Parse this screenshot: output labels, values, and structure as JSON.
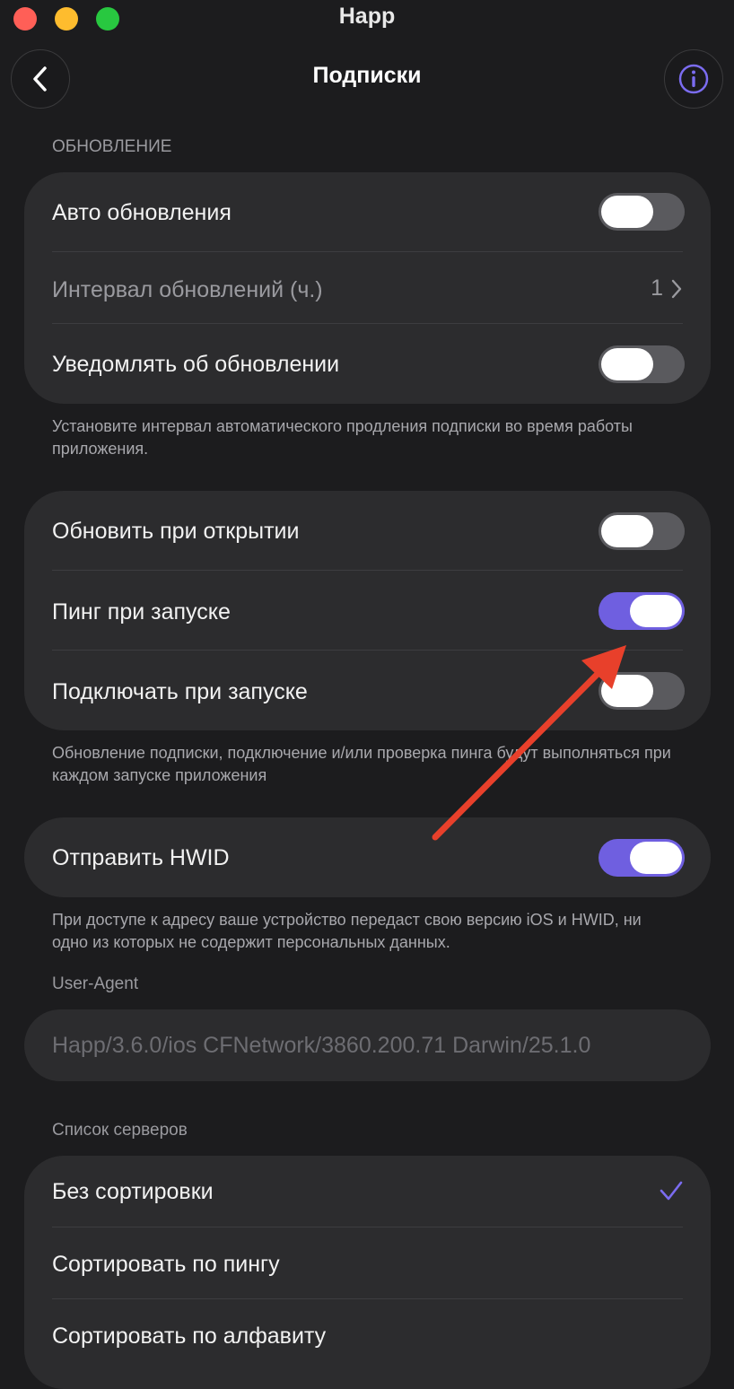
{
  "window": {
    "app_title": "Happ"
  },
  "header": {
    "title": "Подписки",
    "back_icon": "chevron-left-icon",
    "info_icon": "info-icon"
  },
  "update_section": {
    "label": "ОБНОВЛЕНИЕ",
    "auto_update": {
      "label": "Авто обновления",
      "on": false
    },
    "interval": {
      "label": "Интервал обновлений (ч.)",
      "value": "1"
    },
    "notify": {
      "label": "Уведомлять об обновлении",
      "on": false
    },
    "footnote": "Установите интервал автоматического продления подписки во время работы приложения."
  },
  "startup_section": {
    "refresh_on_open": {
      "label": "Обновить при открытии",
      "on": false
    },
    "ping_on_start": {
      "label": "Пинг при запуске",
      "on": true
    },
    "connect_on_start": {
      "label": "Подключать при запуске",
      "on": false
    },
    "footnote": "Обновление подписки, подключение и/или проверка пинга будут выполняться при каждом запуске приложения"
  },
  "hwid_section": {
    "send_hwid": {
      "label": "Отправить HWID",
      "on": true
    },
    "footnote": "При доступе к адресу ваше устройство передаст свою версию iOS и HWID, ни одно из которых не содержит персональных данных."
  },
  "user_agent": {
    "label": "User-Agent",
    "placeholder": "Happ/3.6.0/ios CFNetwork/3860.200.71 Darwin/25.1.0"
  },
  "server_list": {
    "label": "Список серверов",
    "options": [
      {
        "label": "Без сортировки",
        "selected": true
      },
      {
        "label": "Сортировать по пингу",
        "selected": false
      },
      {
        "label": "Сортировать по алфавиту",
        "selected": false
      }
    ]
  },
  "colors": {
    "accent": "#6f5fe0",
    "arrow": "#e8402b",
    "background": "#1c1c1e",
    "card": "#2c2c2e"
  }
}
